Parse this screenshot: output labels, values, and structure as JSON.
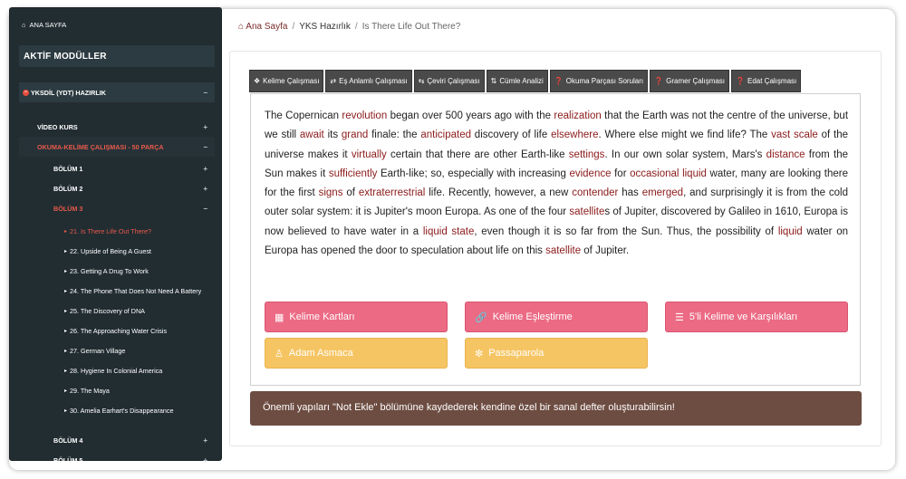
{
  "sidebar": {
    "home_label": "ANA SAYFA",
    "section_title": "AKTİF MODÜLLER",
    "main_module": "YKSDİL (YDT) HAZIRLIK",
    "video_label": "VİDEO KURS",
    "reading_module": "OKUMA-KELİME ÇALIŞMASI - 50 PARÇA",
    "sections": [
      "BÖLÜM 1",
      "BÖLÜM 2",
      "BÖLÜM 3",
      "BÖLÜM 4",
      "BÖLÜM 5"
    ],
    "lessons": [
      "21. Is There Life Out There?",
      "22. Upside of Being A Guest",
      "23. Getting A Drug To Work",
      "24. The Phone That Does Not Need A Battery",
      "25. The Discovery of DNA",
      "26. The Approaching Water Crisis",
      "27. German Village",
      "28. Hygiene In Colonial America",
      "29. The Maya",
      "30. Amelia Earhart's Disappearance"
    ],
    "plus": "+",
    "minus": "−"
  },
  "breadcrumb": {
    "home": "Ana Sayfa",
    "sep": "/",
    "mid": "YKS Hazırlık",
    "last": "Is There Life Out There?"
  },
  "tabs": [
    {
      "label": "Kelime Çalışması",
      "icon": "puzzle-icon"
    },
    {
      "label": "Eş Anlamlı Çalışması",
      "icon": "shuffle-icon"
    },
    {
      "label": "Çeviri Çalışması",
      "icon": "swap-icon"
    },
    {
      "label": "Cümle Analizi",
      "icon": "sort-icon"
    },
    {
      "label": "Okuma Parçası Soruları",
      "icon": "question-icon"
    },
    {
      "label": "Gramer Çalışması",
      "icon": "question-icon"
    },
    {
      "label": "Edat Çalışması",
      "icon": "question-icon"
    }
  ],
  "passage": {
    "segments": [
      {
        "t": "The Copernican ",
        "k": false
      },
      {
        "t": "revolution",
        "k": true
      },
      {
        "t": " began over 500 years ago with the ",
        "k": false
      },
      {
        "t": "realization",
        "k": true
      },
      {
        "t": " that the Earth was not the centre of the universe, but we still ",
        "k": false
      },
      {
        "t": "await",
        "k": true
      },
      {
        "t": " its ",
        "k": false
      },
      {
        "t": "grand",
        "k": true
      },
      {
        "t": " finale: the ",
        "k": false
      },
      {
        "t": "anticipated",
        "k": true
      },
      {
        "t": " discovery of life ",
        "k": false
      },
      {
        "t": "elsewhere",
        "k": true
      },
      {
        "t": ". Where else might we find life? The ",
        "k": false
      },
      {
        "t": "vast scale",
        "k": true
      },
      {
        "t": " of the universe makes it ",
        "k": false
      },
      {
        "t": "virtually",
        "k": true
      },
      {
        "t": " certain that there are other Earth-like ",
        "k": false
      },
      {
        "t": "settings",
        "k": true
      },
      {
        "t": ". In our own solar system, Mars's ",
        "k": false
      },
      {
        "t": "distance",
        "k": true
      },
      {
        "t": " from the Sun makes it ",
        "k": false
      },
      {
        "t": "sufficiently",
        "k": true
      },
      {
        "t": " Earth-like; so, especially with increasing ",
        "k": false
      },
      {
        "t": "evidence",
        "k": true
      },
      {
        "t": " for ",
        "k": false
      },
      {
        "t": "occasional liquid",
        "k": true
      },
      {
        "t": " water, many are looking there for the first ",
        "k": false
      },
      {
        "t": "signs",
        "k": true
      },
      {
        "t": " of ",
        "k": false
      },
      {
        "t": "extraterrestrial",
        "k": true
      },
      {
        "t": " life. Recently, however, a new ",
        "k": false
      },
      {
        "t": "contender",
        "k": true
      },
      {
        "t": " has ",
        "k": false
      },
      {
        "t": "emerged",
        "k": true
      },
      {
        "t": ", and surprisingly it is from the cold outer solar system: it is Jupiter's moon Europa. As one of the four ",
        "k": false
      },
      {
        "t": "satellite",
        "k": true
      },
      {
        "t": "s of Jupiter, discovered by Galileo in 1610, Europa is now believed to have water in a ",
        "k": false
      },
      {
        "t": "liquid state",
        "k": true
      },
      {
        "t": ", even though it is so far from the Sun. Thus, the possibility of ",
        "k": false
      },
      {
        "t": "liquid",
        "k": true
      },
      {
        "t": " water on Europa has opened the door to speculation about life on this ",
        "k": false
      },
      {
        "t": "satellite",
        "k": true
      },
      {
        "t": " of Jupiter.",
        "k": false
      }
    ]
  },
  "buttons": {
    "flashcards": "Kelime Kartları",
    "matching": "Kelime Eşleştirme",
    "five_words": "5'li Kelime ve Karşılıkları",
    "hangman": "Adam Asmaca",
    "passaparola": "Passaparola"
  },
  "note": "Önemli yapıları \"Not Ekle\" bölümüne kaydederek kendine özel bir sanal defter oluşturabilirsin!",
  "colors": {
    "sidebar_bg": "#222d32",
    "active_red": "#e8594a",
    "keyword": "#8b1a1a",
    "pink": "#ec6a84",
    "yellow": "#f6c563",
    "note_bg": "#6d4c41"
  }
}
